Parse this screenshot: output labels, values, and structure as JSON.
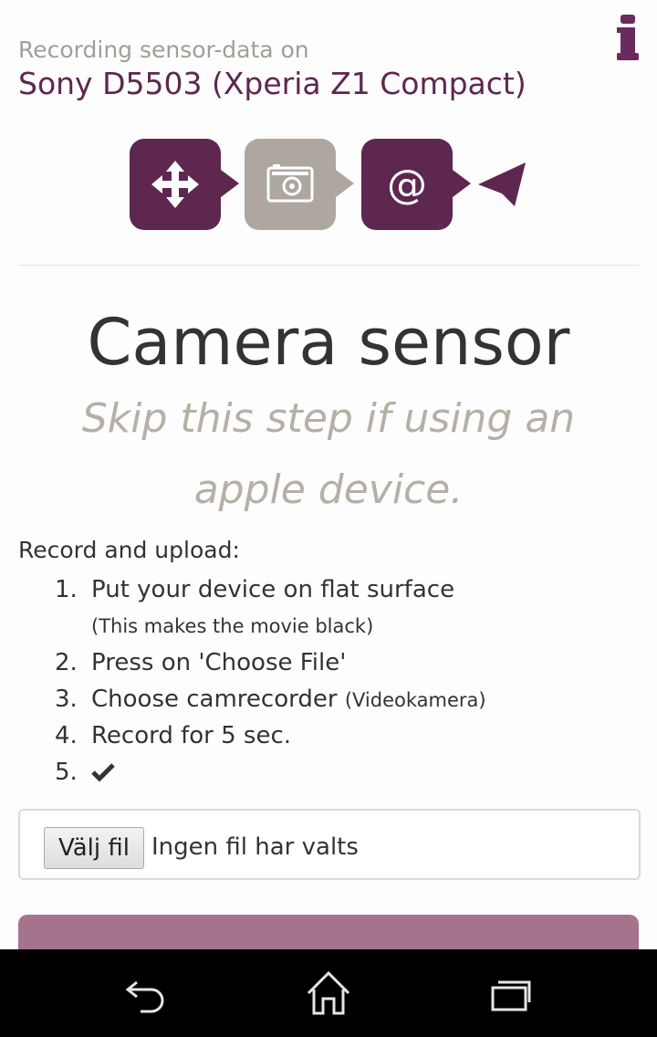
{
  "header": {
    "subtitle": "Recording sensor-data on",
    "device": "Sony D5503 (Xperia Z1 Compact)"
  },
  "colors": {
    "brand": "#5d2750",
    "inactive": "#aea79f",
    "submit": "#a6738d",
    "subtitle_text": "#b5afa5"
  },
  "steps": [
    {
      "icon": "move-arrows-icon",
      "state": "active"
    },
    {
      "icon": "camera-icon",
      "state": "current"
    },
    {
      "icon": "at-sign-icon",
      "label": "@",
      "state": "active"
    },
    {
      "icon": "paper-plane-icon",
      "state": "active"
    }
  ],
  "main": {
    "title": "Camera sensor",
    "subtitle": "Skip this step if using an apple device.",
    "intro": "Record and upload:",
    "items": [
      {
        "num": "1.",
        "text": "Put your device on flat surface"
      },
      {
        "note": "(This makes the movie black)"
      },
      {
        "num": "2.",
        "text": "Press on 'Choose File'"
      },
      {
        "num": "3.",
        "text": "Choose camrecorder",
        "small": "(Videokamera)"
      },
      {
        "num": "4.",
        "text": "Record for 5 sec."
      },
      {
        "num": "5.",
        "icon": "checkmark-icon"
      }
    ]
  },
  "file_input": {
    "button_label": "Välj fil",
    "status": "Ingen fil har valts"
  },
  "navbar": {
    "icons": [
      "back-icon",
      "home-icon",
      "recent-apps-icon"
    ]
  }
}
